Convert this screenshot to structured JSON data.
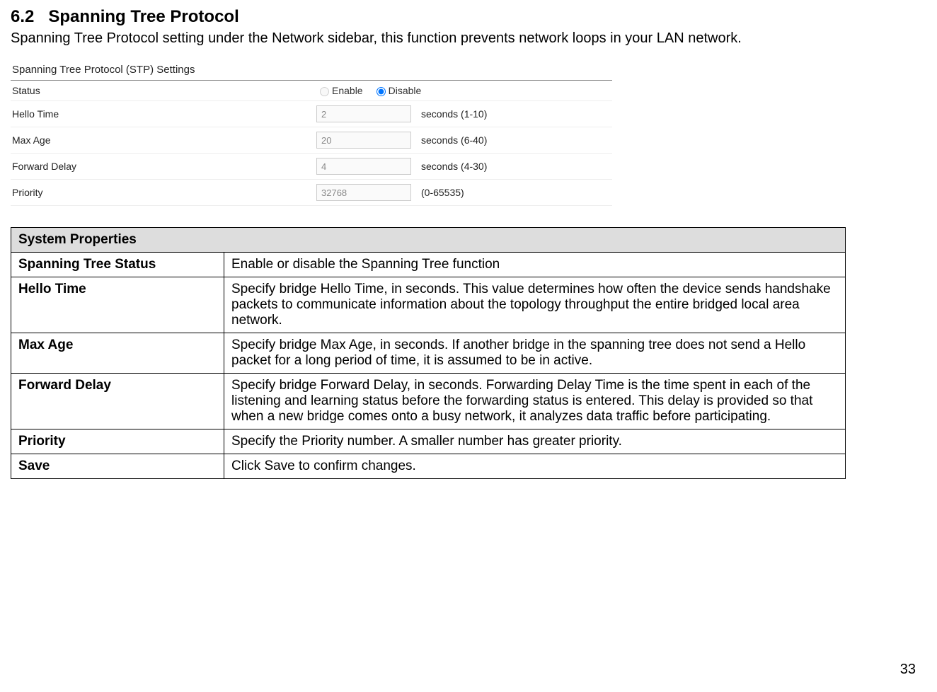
{
  "section": {
    "number": "6.2",
    "title": "Spanning Tree Protocol",
    "description": "Spanning Tree Protocol setting under the Network sidebar, this function prevents network loops in your LAN network."
  },
  "panel": {
    "title": "Spanning Tree Protocol (STP) Settings",
    "rows": {
      "status": {
        "label": "Status",
        "enable": "Enable",
        "disable": "Disable"
      },
      "hello": {
        "label": "Hello Time",
        "value": "2",
        "suffix": "seconds (1-10)"
      },
      "maxage": {
        "label": "Max Age",
        "value": "20",
        "suffix": "seconds (6-40)"
      },
      "fwd": {
        "label": "Forward Delay",
        "value": "4",
        "suffix": "seconds (4-30)"
      },
      "prio": {
        "label": "Priority",
        "value": "32768",
        "suffix": "(0-65535)"
      }
    }
  },
  "table": {
    "header": "System Properties",
    "rows": {
      "status": {
        "name": "Spanning Tree Status",
        "desc": "Enable or disable the Spanning Tree function"
      },
      "hello": {
        "name": "Hello Time",
        "desc": "Specify bridge Hello Time, in seconds. This value determines how often the device sends handshake packets to communicate information about the topology throughput the entire bridged local area network."
      },
      "maxage": {
        "name": "Max Age",
        "desc": "Specify bridge Max Age, in seconds. If another bridge in the spanning tree does not send a Hello packet for a long period of time, it is assumed to be in active."
      },
      "fwd": {
        "name": "Forward Delay",
        "desc": "Specify bridge Forward Delay, in seconds. Forwarding Delay Time is the time spent in each of the listening and learning status before the forwarding status is entered. This delay is provided so that when a new bridge comes onto a busy network, it analyzes data traffic before participating."
      },
      "prio": {
        "name": "Priority",
        "desc": "Specify the Priority number. A smaller number has greater priority."
      },
      "save": {
        "name": "Save",
        "desc": "Click Save to confirm changes."
      }
    }
  },
  "page_number": "33"
}
